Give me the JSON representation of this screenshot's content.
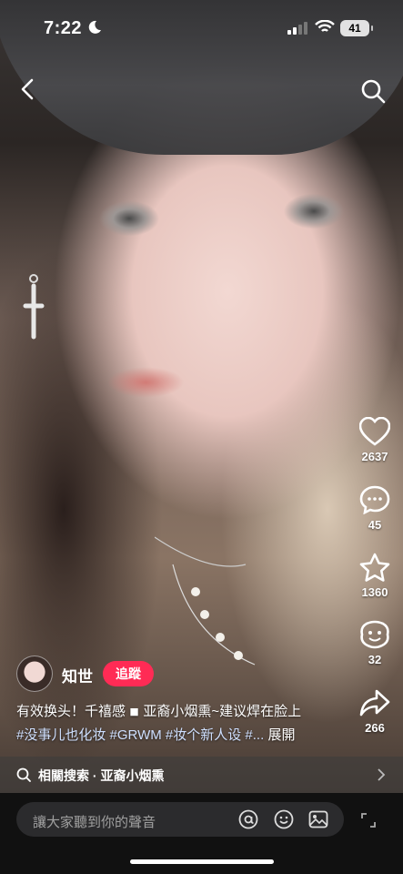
{
  "status": {
    "time": "7:22",
    "battery": "41"
  },
  "video": {
    "likes": "2637",
    "comments": "45",
    "favorites": "1360",
    "shares_count": "32",
    "forwards": "266"
  },
  "author": {
    "name": "知世",
    "follow_label": "追蹤"
  },
  "caption": {
    "line1": "有效换头！千禧感 ◾ 亚裔小烟熏~建议焊在脸上",
    "line2": "#没事儿也化妆 #GRWM #妆个新人设 #...",
    "expand_label": "展開"
  },
  "related_search": {
    "text": "相關搜索 · 亚裔小烟熏"
  },
  "comment_input": {
    "placeholder": "讓大家聽到你的聲音"
  },
  "icons": [
    "back-icon",
    "search-icon",
    "heart-icon",
    "comment-icon",
    "star-icon",
    "share-emoji-icon",
    "forward-icon",
    "at-icon",
    "emoji-icon",
    "image-icon",
    "expand-icon",
    "moon-icon",
    "signal-icon",
    "wifi-icon"
  ]
}
